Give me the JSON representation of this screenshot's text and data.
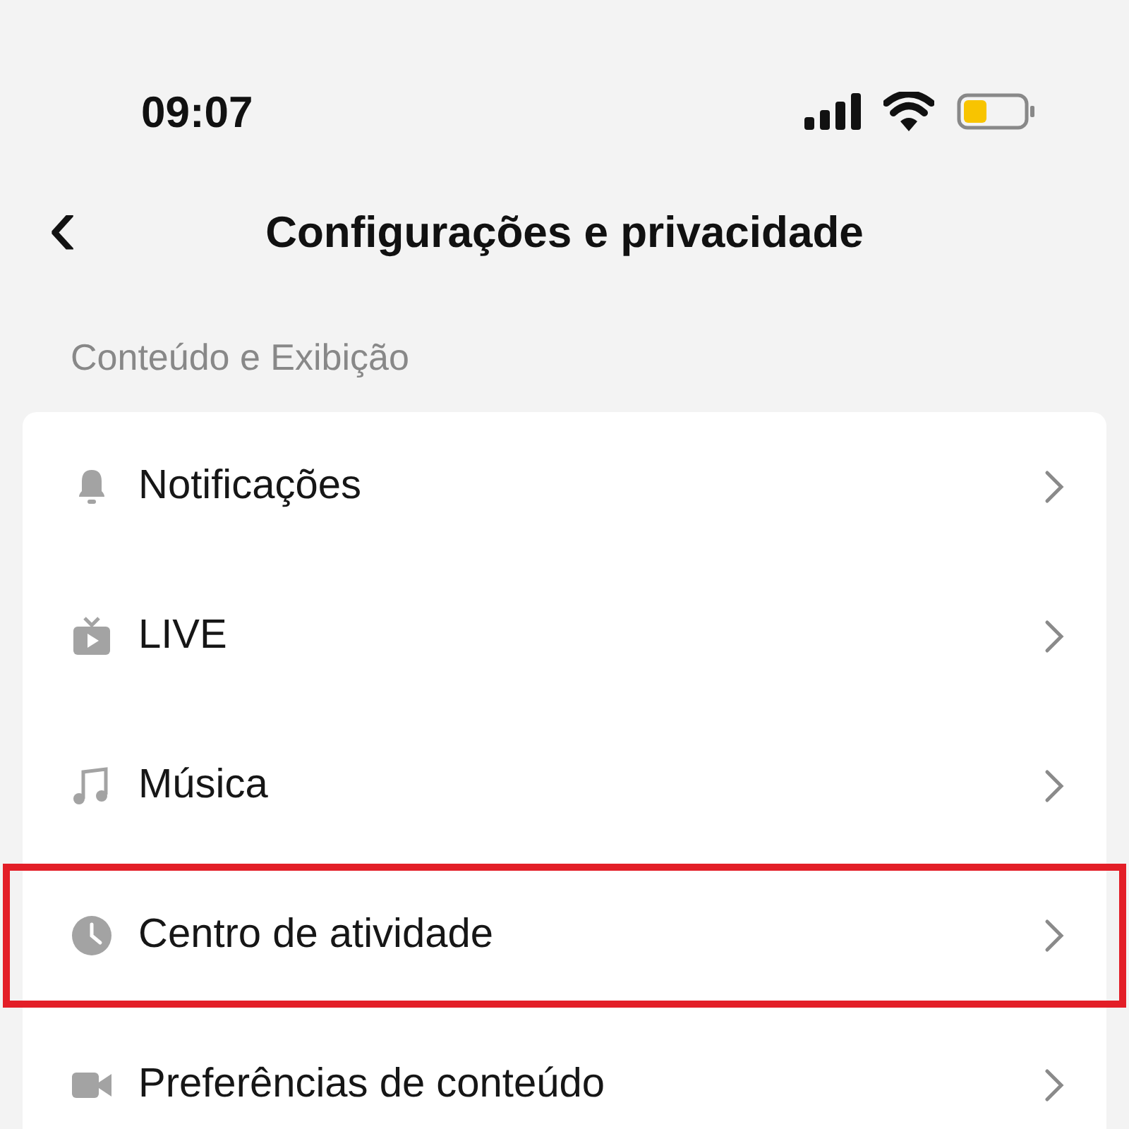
{
  "status_bar": {
    "time": "09:07"
  },
  "header": {
    "back": "‹",
    "title": "Configurações e privacidade"
  },
  "section": {
    "label": "Conteúdo e Exibição"
  },
  "items": [
    {
      "label": "Notificações",
      "highlighted": false
    },
    {
      "label": "LIVE",
      "highlighted": false
    },
    {
      "label": "Música",
      "highlighted": false
    },
    {
      "label": "Centro de atividade",
      "highlighted": true
    },
    {
      "label": "Preferências de conteúdo",
      "highlighted": false
    }
  ]
}
